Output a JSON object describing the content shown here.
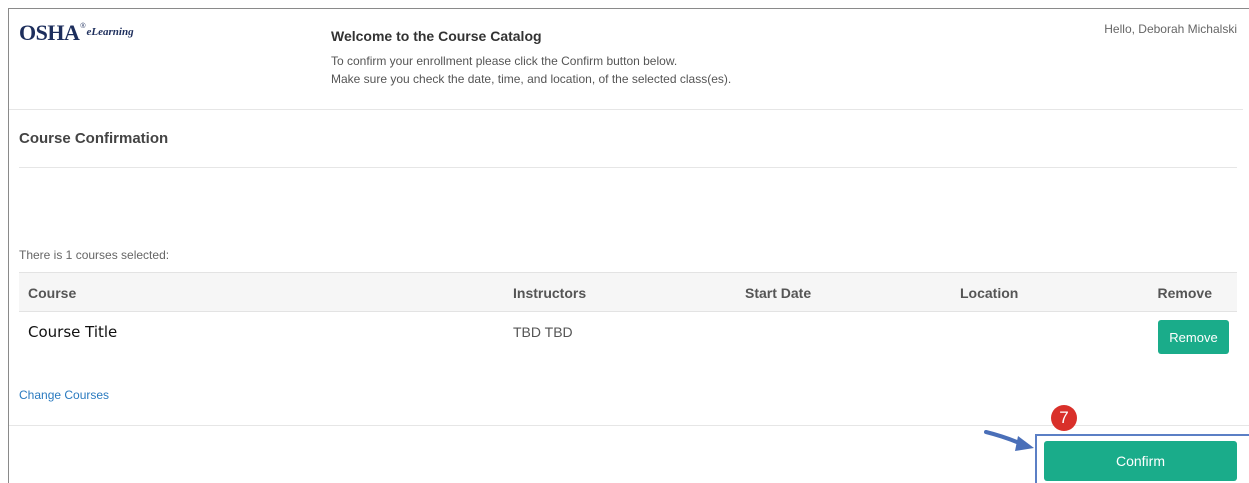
{
  "header": {
    "logo_text": "OSHA",
    "logo_reg": "®",
    "logo_sub": "eLearning",
    "title": "Welcome to the Course Catalog",
    "line1": "To confirm your enrollment please click the Confirm button below.",
    "line2": "Make sure you check the date, time, and location, of the selected class(es).",
    "greeting": "Hello, Deborah Michalski"
  },
  "section": {
    "title": "Course Confirmation",
    "selected_note": "There is 1 courses selected:"
  },
  "table": {
    "headers": {
      "course": "Course",
      "instructors": "Instructors",
      "start_date": "Start Date",
      "location": "Location",
      "remove": "Remove"
    },
    "rows": [
      {
        "course": "Course Title",
        "instructors": "TBD TBD",
        "start_date": "",
        "location": "",
        "remove_label": "Remove"
      }
    ]
  },
  "footer": {
    "change_courses": "Change Courses",
    "confirm_label": "Confirm",
    "step_number": "7"
  },
  "colors": {
    "accent_green": "#1aac8a",
    "link_blue": "#2a7abf",
    "badge_red": "#d9302a",
    "highlight_blue": "#5b7fc5"
  }
}
